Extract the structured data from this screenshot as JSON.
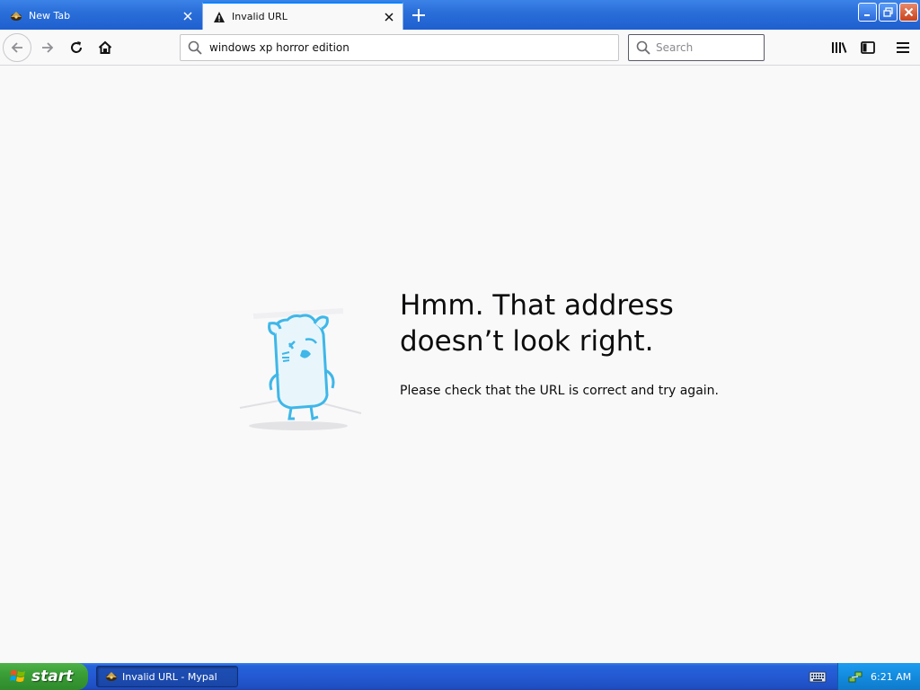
{
  "tabs": [
    {
      "label": "New Tab",
      "icon": "mypal-logo-icon",
      "active": false
    },
    {
      "label": "Invalid URL",
      "icon": "warning-icon",
      "active": true
    }
  ],
  "window_controls": [
    "minimize",
    "restore",
    "close"
  ],
  "nav": {
    "url_value": "windows xp horror edition",
    "search_placeholder": "Search"
  },
  "error_page": {
    "title": "Hmm. That address doesn’t look right.",
    "description": "Please check that the URL is correct and try again."
  },
  "taskbar": {
    "start_label": "start",
    "task_label": "Invalid URL - Mypal",
    "clock": "6:21 AM"
  },
  "colors": {
    "tab_strip": "#2a6fd9",
    "content_bg": "#f9f9fa",
    "accent": "#0a84ff",
    "start_green": "#3a9e36",
    "taskbar_blue": "#2459d3"
  }
}
